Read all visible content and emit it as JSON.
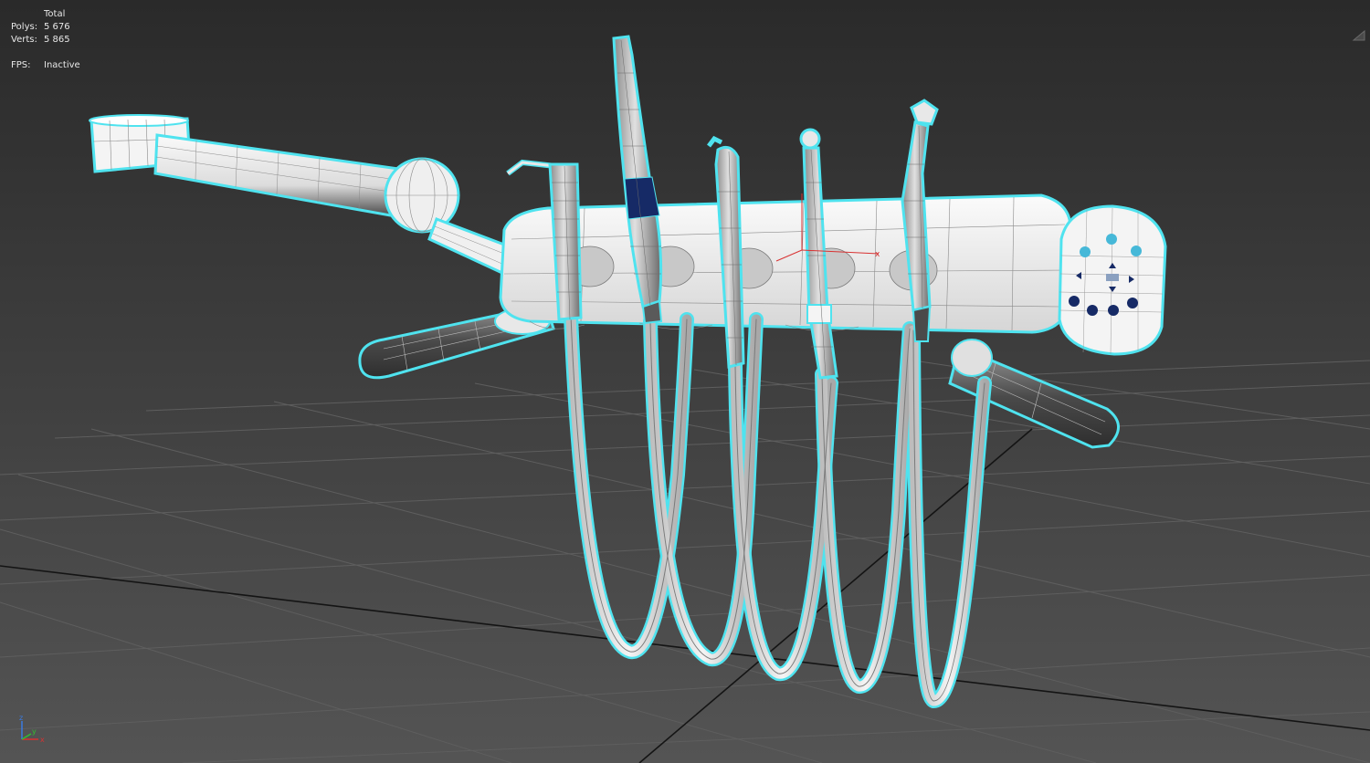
{
  "stats": {
    "header": "Total",
    "polys_label": "Polys:",
    "polys_value": "5 676",
    "verts_label": "Verts:",
    "verts_value": "5 865",
    "fps_label": "FPS:",
    "fps_value": "Inactive"
  },
  "axes": {
    "x_label": "x",
    "y_label": "y",
    "z_label": "z"
  },
  "colors": {
    "background_top": "#2a2a2a",
    "background_bottom": "#525252",
    "grid_line": "#5e5e5e",
    "grid_axis": "#141414",
    "selection_outline": "#4fe3ef",
    "model_fill": "#f2f2f2",
    "model_wire": "#6a6a6a",
    "dark_part": "#4a4a4a",
    "accent_blue": "#162a66",
    "accent_light_blue": "#46b8d8",
    "axis_x": "#d83232",
    "axis_y": "#30c030",
    "axis_z": "#3a7ae0"
  },
  "icons": {
    "scene_model": "dental-unit-wireframe",
    "gizmo": "transform-gizmo-icon",
    "tripod": "axis-tripod-icon"
  }
}
